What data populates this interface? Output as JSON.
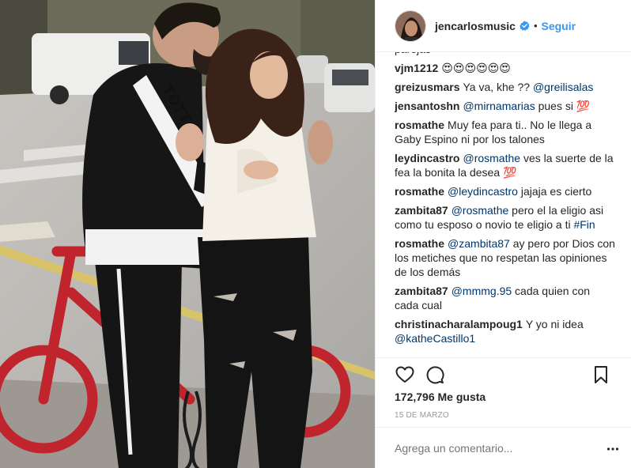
{
  "post": {
    "photo_icon": "photo",
    "header": {
      "username": "jencarlosmusic",
      "verified_icon": "verified-badge-icon",
      "separator": "•",
      "follow_label": "Seguir",
      "accent_color": "#3897f0"
    },
    "comments": [
      {
        "user": "",
        "text": "parejas",
        "mention": "",
        "tag": ""
      },
      {
        "user": "vjm1212",
        "text": "😍😍😍😍😍😍",
        "mention": "",
        "tag": ""
      },
      {
        "user": "greizusmars",
        "text": "Ya va, khe ?? ",
        "mention": "@greilisalas",
        "tag": ""
      },
      {
        "user": "jensantoshn",
        "text": "",
        "mention": "@mirnamarias",
        "after": " pues si 💯",
        "tag": ""
      },
      {
        "user": "rosmathe",
        "text": "Muy fea para ti.. No le llega a Gaby Espino ni por los talones",
        "mention": "",
        "tag": ""
      },
      {
        "user": "leydincastro",
        "text": "",
        "mention": "@rosmathe",
        "after": " ves la suerte de la fea la bonita la desea 💯",
        "tag": ""
      },
      {
        "user": "rosmathe",
        "text": "",
        "mention": "@leydincastro",
        "after": " jajaja es cierto",
        "tag": ""
      },
      {
        "user": "zambita87",
        "text": "",
        "mention": "@rosmathe",
        "after": " pero el la eligio asi como tu esposo o novio te eligio a ti ",
        "tag": "#Fin"
      },
      {
        "user": "rosmathe",
        "text": "",
        "mention": "@zambita87",
        "after": " ay pero por Dios con los metiches que no respetan las opiniones de los demás",
        "tag": ""
      },
      {
        "user": "zambita87",
        "text": "",
        "mention": "@mmmg.95",
        "after": " cada quien con cada cual",
        "tag": ""
      },
      {
        "user": "christinacharalampoug1",
        "text": "Y yo ni idea ",
        "mention": "@katheCastillo1",
        "tag": ""
      }
    ],
    "actions": {
      "like_icon": "heart-icon",
      "comment_icon": "comment-bubble-icon",
      "save_icon": "bookmark-icon"
    },
    "likes_label": "172,796 Me gusta",
    "date_label": "15 DE MARZO",
    "add_comment": {
      "placeholder": "Agrega un comentario...",
      "more_icon": "more-options-icon"
    }
  }
}
